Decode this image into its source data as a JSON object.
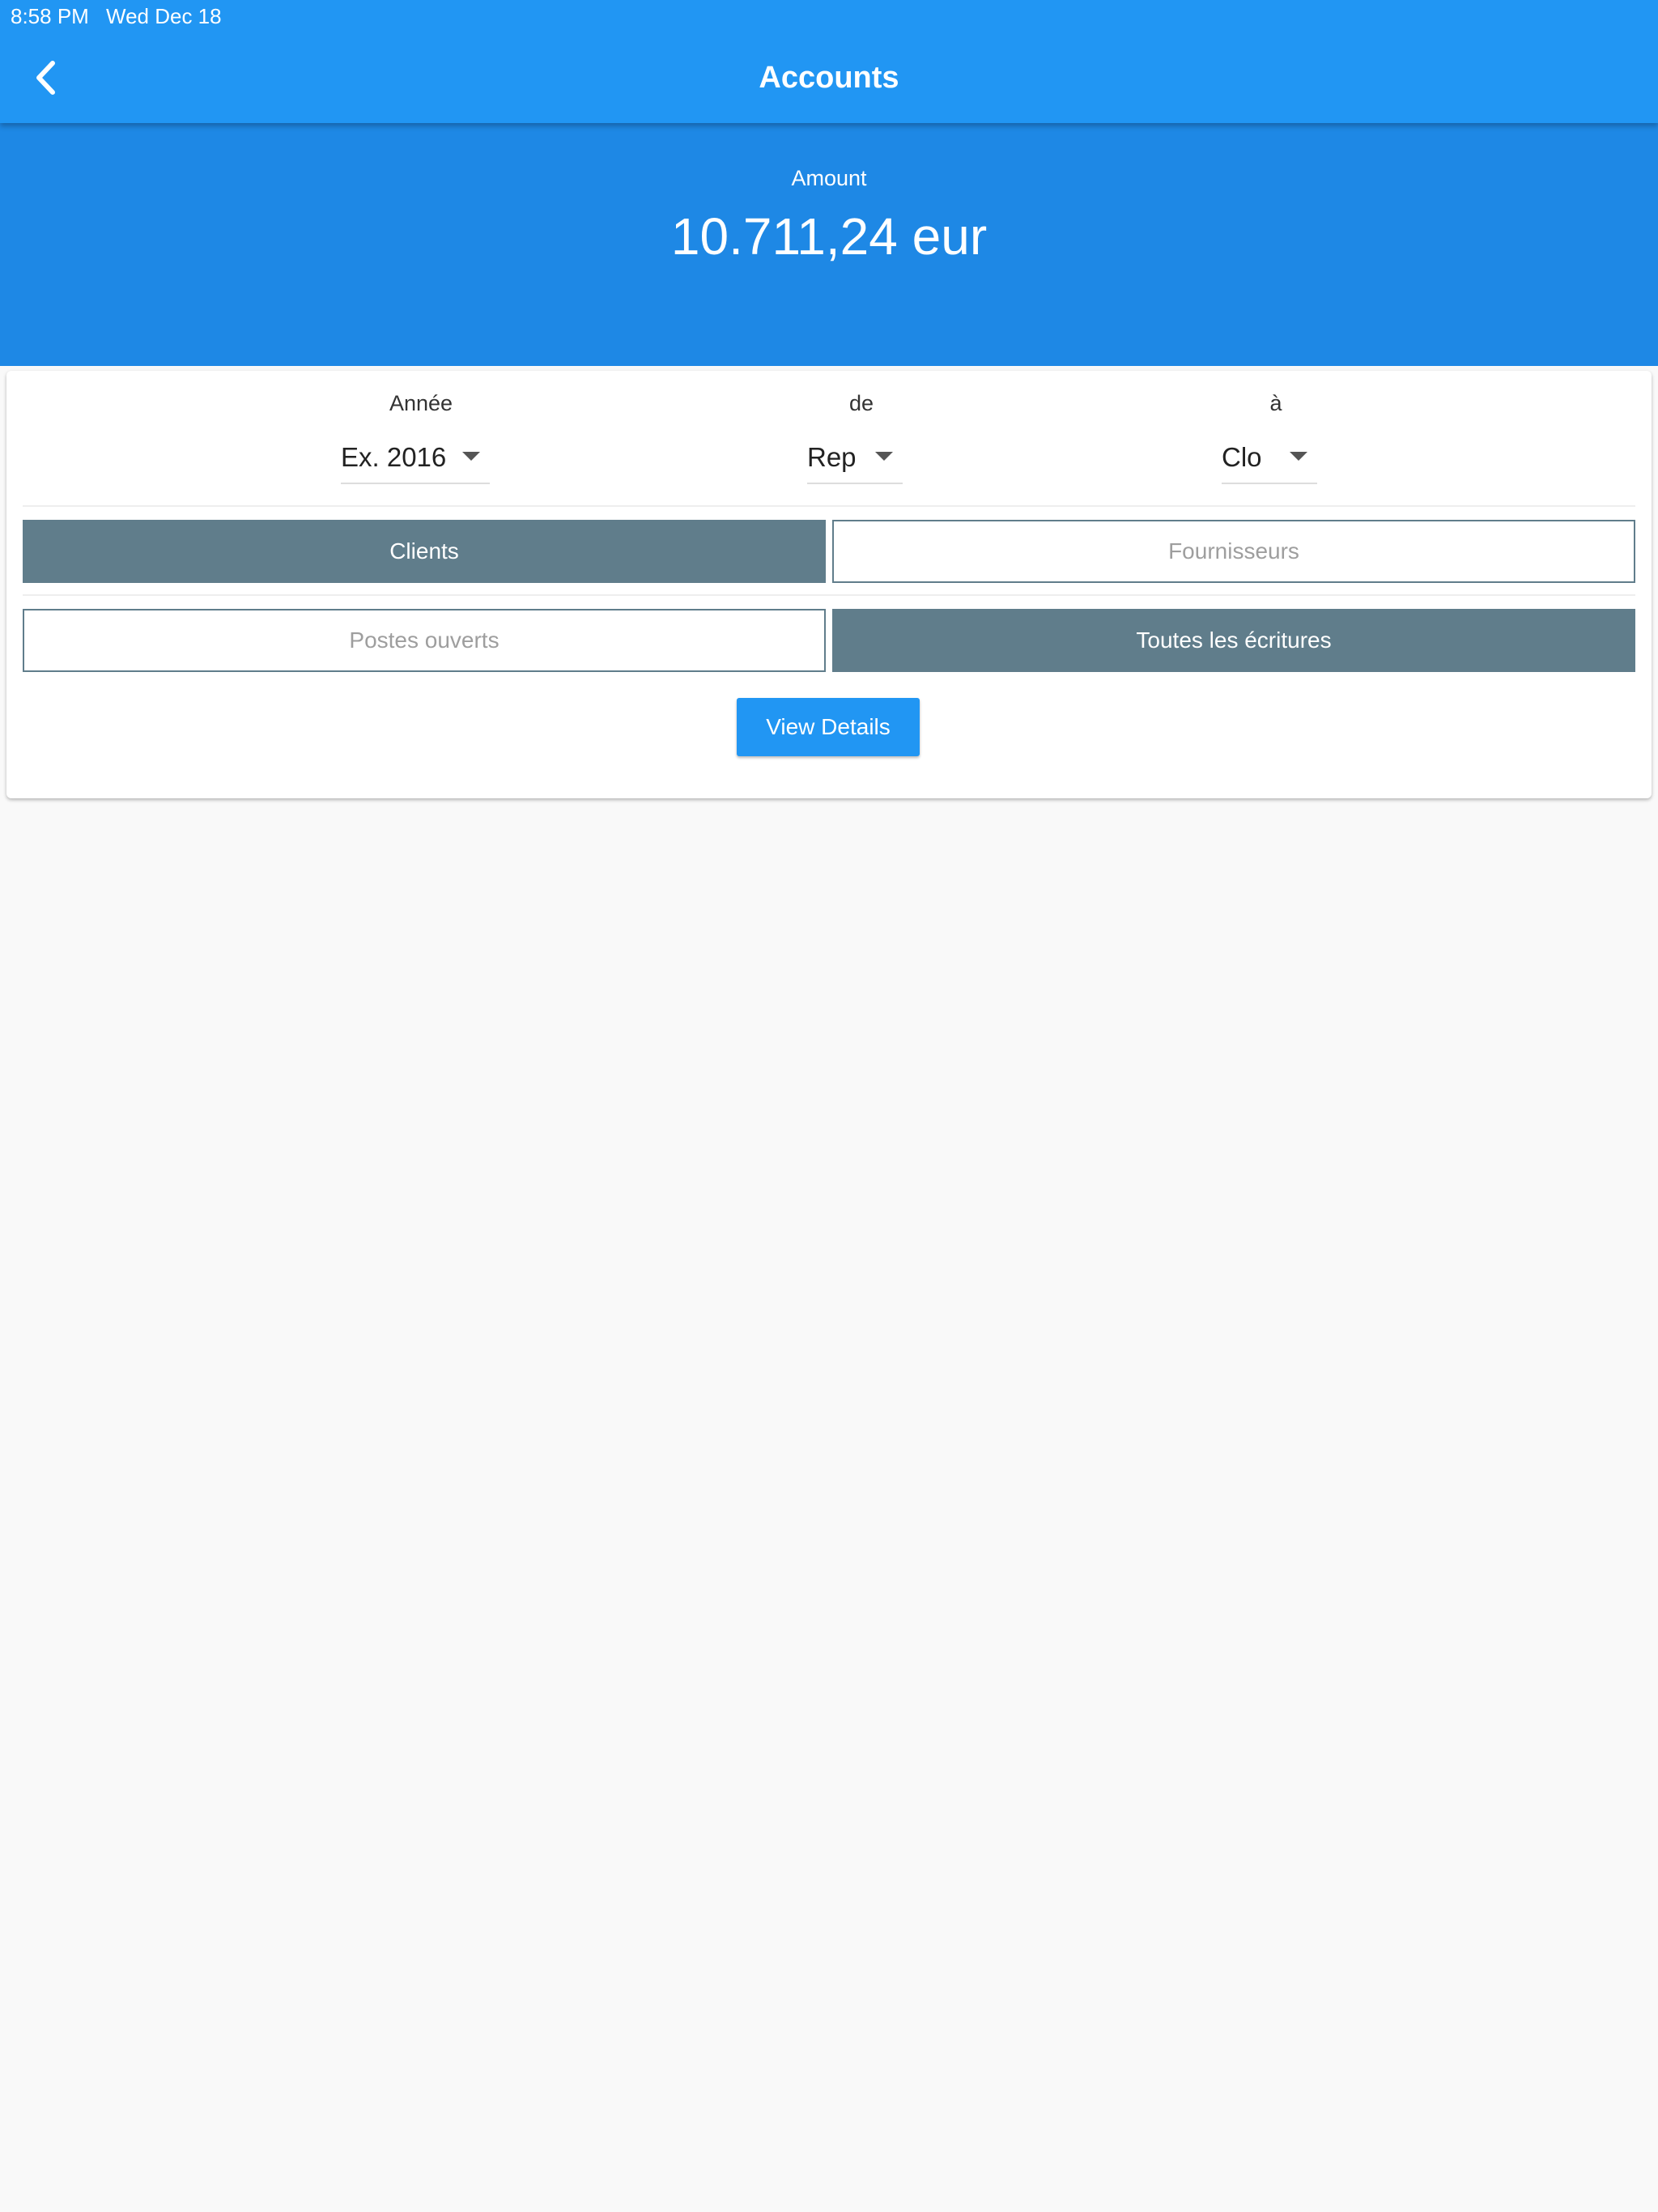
{
  "status_bar": {
    "time": "8:58 PM",
    "date": "Wed Dec 18"
  },
  "header": {
    "title": "Accounts",
    "back_icon": "chevron-left-icon"
  },
  "summary": {
    "label": "Amount",
    "value": "10.711,24 eur"
  },
  "filters": {
    "year": {
      "label": "Année",
      "value": "Ex. 2016"
    },
    "from": {
      "label": "de",
      "value": "Rep"
    },
    "to": {
      "label": "à",
      "value": "Clo"
    }
  },
  "account_type": {
    "options": [
      "Clients",
      "Fournisseurs"
    ],
    "selected": "Clients"
  },
  "entry_scope": {
    "options": [
      "Postes ouverts",
      "Toutes les écritures"
    ],
    "selected": "Toutes les écritures"
  },
  "actions": {
    "view_details_label": "View Details"
  },
  "colors": {
    "primary": "#2196f3",
    "primary_dark": "#1e88e5",
    "segment_active": "#607d8b",
    "background": "#f9f9f9"
  }
}
